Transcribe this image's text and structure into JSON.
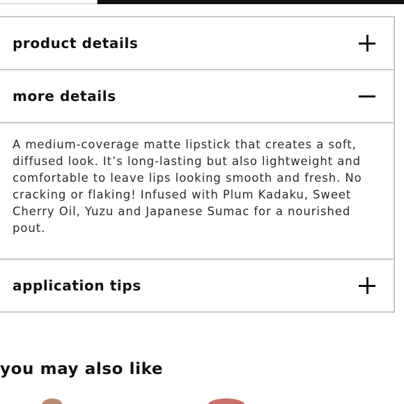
{
  "accordion": {
    "sections": [
      {
        "title": "product details",
        "toggle": "expand",
        "expanded": false
      },
      {
        "title": "more details",
        "toggle": "collapse",
        "expanded": true,
        "body": "A medium-coverage matte lipstick that creates a soft, diffused look. It’s long-lasting but also lightweight and comfortable to leave lips looking smooth and fresh. No cracking or flaking! Infused with Plum Kadaku, Sweet Cherry Oil, Yuzu and Japanese Sumac for a nourished pout."
      },
      {
        "title": "application tips",
        "toggle": "expand",
        "expanded": false
      }
    ]
  },
  "recommendations": {
    "title": "you may also like",
    "thumb_colors": [
      "#b98a73",
      "#c96f6a"
    ]
  }
}
